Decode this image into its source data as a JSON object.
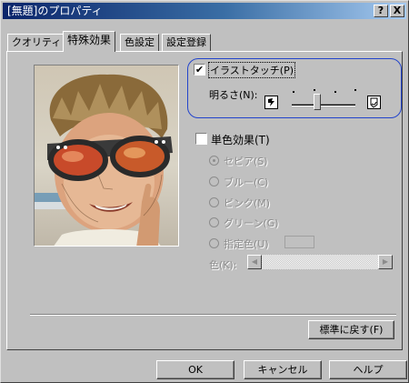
{
  "window": {
    "title": "[無題]のプロパティ",
    "help_glyph": "?",
    "close_glyph": "X"
  },
  "tabs": [
    {
      "label": "クオリティ",
      "active": false
    },
    {
      "label": "特殊効果",
      "active": true
    },
    {
      "label": "色設定",
      "active": false
    },
    {
      "label": "設定登録",
      "active": false
    }
  ],
  "preview": {
    "icon": "photo-preview-boy-in-sunglasses"
  },
  "illustration": {
    "checkbox_label": "イラストタッチ(P)",
    "checked": true,
    "check_glyph": "✔",
    "brightness_label": "明るさ(N):",
    "brightness_level": 0.4,
    "min_icon": "brightness-low-icon",
    "max_icon": "brightness-high-icon"
  },
  "mono": {
    "checkbox_label": "単色効果(T)",
    "checked": false,
    "options": [
      {
        "label": "セピア(S)",
        "selected": true
      },
      {
        "label": "ブルー(C)",
        "selected": false
      },
      {
        "label": "ピンク(M)",
        "selected": false
      },
      {
        "label": "グリーン(G)",
        "selected": false
      },
      {
        "label": "指定色(U)",
        "selected": false
      }
    ],
    "color_label": "色(K):"
  },
  "buttons": {
    "reset": "標準に戻す(F)",
    "ok": "OK",
    "cancel": "キャンセル",
    "help": "ヘルプ"
  },
  "colors": {
    "highlight_border": "#2244cc",
    "titlebar_start": "#0a246a",
    "face": "#c0c0c0"
  }
}
